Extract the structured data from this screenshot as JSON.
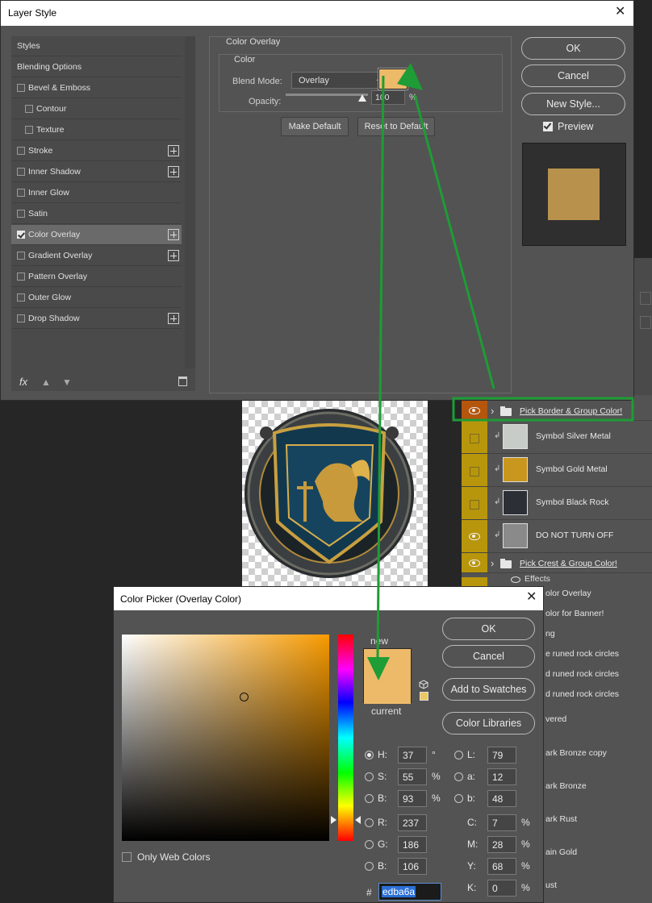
{
  "layer_style": {
    "title": "Layer Style",
    "styles_list": [
      {
        "label": "Styles",
        "checkbox": false,
        "checked": false,
        "plus": false,
        "indent": false,
        "selected": false
      },
      {
        "label": "Blending Options",
        "checkbox": false,
        "checked": false,
        "plus": false,
        "indent": false,
        "selected": false
      },
      {
        "label": "Bevel & Emboss",
        "checkbox": true,
        "checked": false,
        "plus": false,
        "indent": false,
        "selected": false
      },
      {
        "label": "Contour",
        "checkbox": true,
        "checked": false,
        "plus": false,
        "indent": true,
        "selected": false
      },
      {
        "label": "Texture",
        "checkbox": true,
        "checked": false,
        "plus": false,
        "indent": true,
        "selected": false
      },
      {
        "label": "Stroke",
        "checkbox": true,
        "checked": false,
        "plus": true,
        "indent": false,
        "selected": false
      },
      {
        "label": "Inner Shadow",
        "checkbox": true,
        "checked": false,
        "plus": true,
        "indent": false,
        "selected": false
      },
      {
        "label": "Inner Glow",
        "checkbox": true,
        "checked": false,
        "plus": false,
        "indent": false,
        "selected": false
      },
      {
        "label": "Satin",
        "checkbox": true,
        "checked": false,
        "plus": false,
        "indent": false,
        "selected": false
      },
      {
        "label": "Color Overlay",
        "checkbox": true,
        "checked": true,
        "plus": true,
        "indent": false,
        "selected": true
      },
      {
        "label": "Gradient Overlay",
        "checkbox": true,
        "checked": false,
        "plus": true,
        "indent": false,
        "selected": false
      },
      {
        "label": "Pattern Overlay",
        "checkbox": true,
        "checked": false,
        "plus": false,
        "indent": false,
        "selected": false
      },
      {
        "label": "Outer Glow",
        "checkbox": true,
        "checked": false,
        "plus": false,
        "indent": false,
        "selected": false
      },
      {
        "label": "Drop Shadow",
        "checkbox": true,
        "checked": false,
        "plus": true,
        "indent": false,
        "selected": false
      }
    ],
    "fx_label": "fx",
    "section_title": "Color Overlay",
    "group_title": "Color",
    "blend_mode_label": "Blend Mode:",
    "blend_mode_value": "Overlay",
    "overlay_color": "#edba6a",
    "opacity_label": "Opacity:",
    "opacity_value": "100",
    "opacity_unit": "%",
    "make_default": "Make Default",
    "reset_default": "Reset to Default",
    "ok": "OK",
    "cancel": "Cancel",
    "new_style": "New Style...",
    "preview_label": "Preview",
    "preview_color": "#b8924d"
  },
  "layers": {
    "rows": [
      {
        "name": "Pick Border & Group Color!",
        "visible": true,
        "type": "group",
        "underline": true,
        "eye_color": "orange"
      },
      {
        "name": "Symbol Silver Metal",
        "visible": false,
        "type": "layer",
        "thumb": "#c8ccc8"
      },
      {
        "name": "Symbol Gold Metal",
        "visible": false,
        "type": "layer",
        "thumb": "#c9961e"
      },
      {
        "name": "Symbol Black Rock",
        "visible": false,
        "type": "layer",
        "thumb": "#2c2f36"
      },
      {
        "name": "DO NOT TURN OFF",
        "visible": true,
        "type": "layer",
        "thumb": "#8a8a8a"
      },
      {
        "name": "Pick Crest & Group Color!",
        "visible": true,
        "type": "group",
        "underline": true
      }
    ],
    "effects_label": "Effects",
    "partial_rows": [
      "olor Overlay",
      "olor for Banner!",
      "ng",
      "e runed rock circles",
      "d runed rock circles",
      "d runed rock circles",
      "vered",
      "ark Bronze copy",
      "ark Bronze",
      "ark Rust",
      "ain Gold",
      "ust"
    ]
  },
  "color_picker": {
    "title": "Color Picker (Overlay Color)",
    "ok": "OK",
    "cancel": "Cancel",
    "add_to_swatches": "Add to Swatches",
    "color_libraries": "Color Libraries",
    "new_label": "new",
    "current_label": "current",
    "new_color": "#edba6a",
    "current_color": "#edba6a",
    "only_web_colors": "Only Web Colors",
    "hsb": [
      {
        "label": "H:",
        "value": "37",
        "unit": "°",
        "selected": true
      },
      {
        "label": "S:",
        "value": "55",
        "unit": "%",
        "selected": false
      },
      {
        "label": "B:",
        "value": "93",
        "unit": "%",
        "selected": false
      }
    ],
    "rgb": [
      {
        "label": "R:",
        "value": "237"
      },
      {
        "label": "G:",
        "value": "186"
      },
      {
        "label": "B:",
        "value": "106"
      }
    ],
    "lab": [
      {
        "label": "L:",
        "value": "79"
      },
      {
        "label": "a:",
        "value": "12"
      },
      {
        "label": "b:",
        "value": "48"
      }
    ],
    "cmyk": [
      {
        "label": "C:",
        "value": "7",
        "unit": "%"
      },
      {
        "label": "M:",
        "value": "28",
        "unit": "%"
      },
      {
        "label": "Y:",
        "value": "68",
        "unit": "%"
      },
      {
        "label": "K:",
        "value": "0",
        "unit": "%"
      }
    ],
    "hash": "#",
    "hex": "edba6a"
  },
  "annotation_color": "#1e9c35"
}
